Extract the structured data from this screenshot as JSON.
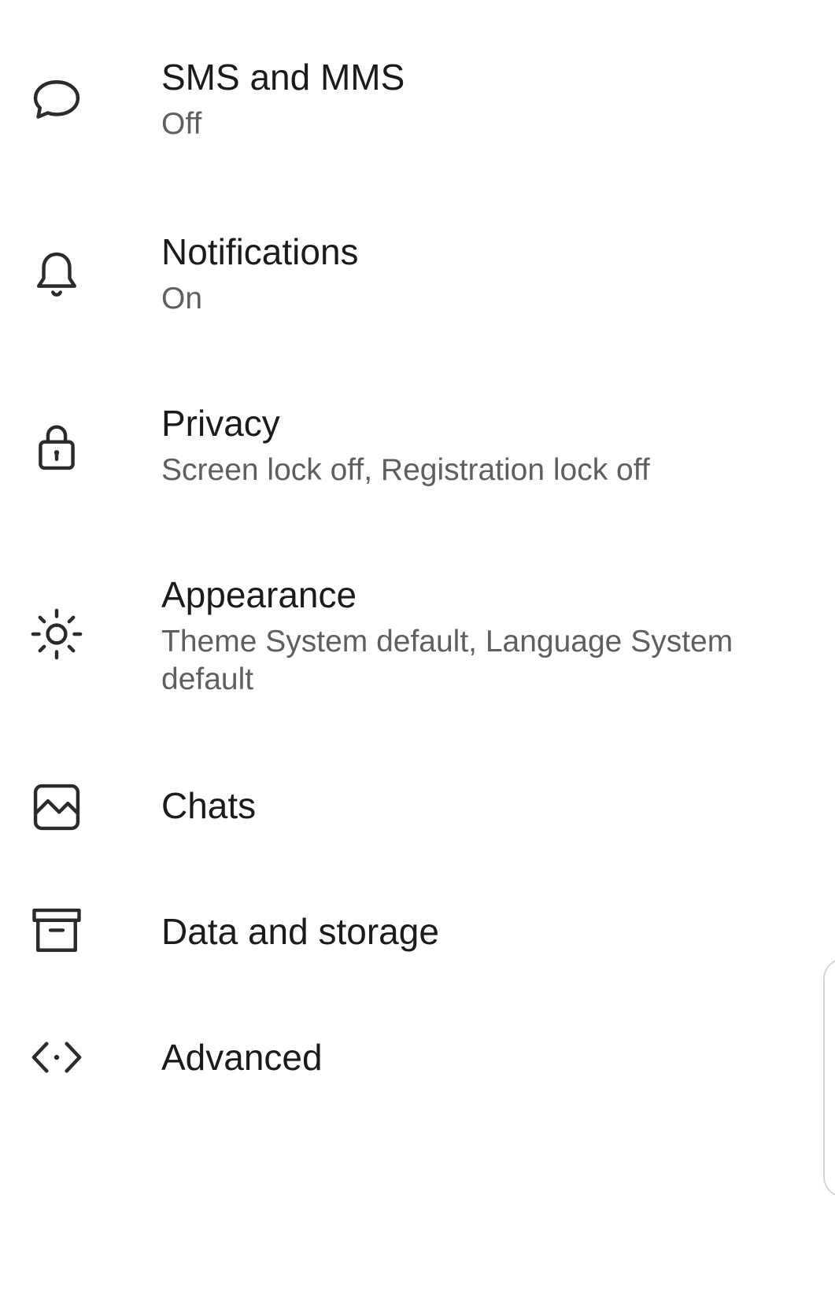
{
  "settings": {
    "items": [
      {
        "icon": "chat-bubble-icon",
        "title": "SMS and MMS",
        "subtitle": "Off"
      },
      {
        "icon": "bell-icon",
        "title": "Notifications",
        "subtitle": "On"
      },
      {
        "icon": "lock-icon",
        "title": "Privacy",
        "subtitle": "Screen lock off, Registration lock off"
      },
      {
        "icon": "sun-icon",
        "title": "Appearance",
        "subtitle": "Theme System default, Language System default"
      },
      {
        "icon": "image-icon",
        "title": "Chats"
      },
      {
        "icon": "archive-box-icon",
        "title": "Data and storage"
      },
      {
        "icon": "code-icon",
        "title": "Advanced"
      }
    ]
  },
  "colors": {
    "background": "#ffffff",
    "title_text": "#1b1b1b",
    "subtitle_text": "#5f5f5f",
    "icon_stroke": "#2b2b2b"
  }
}
